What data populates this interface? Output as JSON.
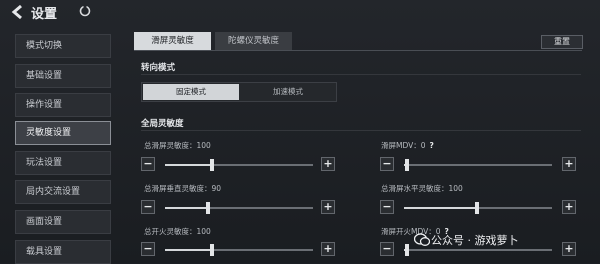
{
  "header": {
    "title": "设置"
  },
  "sidebar": {
    "items": [
      {
        "label": "模式切换"
      },
      {
        "label": "基础设置"
      },
      {
        "label": "操作设置"
      },
      {
        "label": "灵敏度设置",
        "active": true
      },
      {
        "label": "玩法设置"
      },
      {
        "label": "局内交流设置"
      },
      {
        "label": "画面设置"
      },
      {
        "label": "载具设置"
      }
    ]
  },
  "tabs": [
    {
      "label": "滑屏灵敏度",
      "active": true
    },
    {
      "label": "陀螺仪灵敏度"
    }
  ],
  "reset_label": "重置",
  "turn_mode": {
    "title": "转向模式",
    "options": [
      {
        "label": "固定模式",
        "selected": true
      },
      {
        "label": "加速模式"
      }
    ]
  },
  "global": {
    "title": "全局灵敏度",
    "sliders": [
      {
        "label": "总滑屏灵敏度：100",
        "fraction": 0.32
      },
      {
        "label": "滑屏MDV：0",
        "help": "?",
        "fraction": 0.02
      },
      {
        "label": "总滑屏垂直灵敏度：90",
        "fraction": 0.29
      },
      {
        "label": "总滑屏水平灵敏度：100",
        "fraction": 0.49
      },
      {
        "label": "总开火灵敏度：100",
        "fraction": 0.32
      },
      {
        "label": "滑屏开火MDV：0",
        "help": "?",
        "fraction": 0.02
      }
    ]
  },
  "watermark": "公众号 · 游戏萝卜",
  "colors": {
    "accent_tab": "#d7dadd",
    "background": "#1c1f24"
  }
}
